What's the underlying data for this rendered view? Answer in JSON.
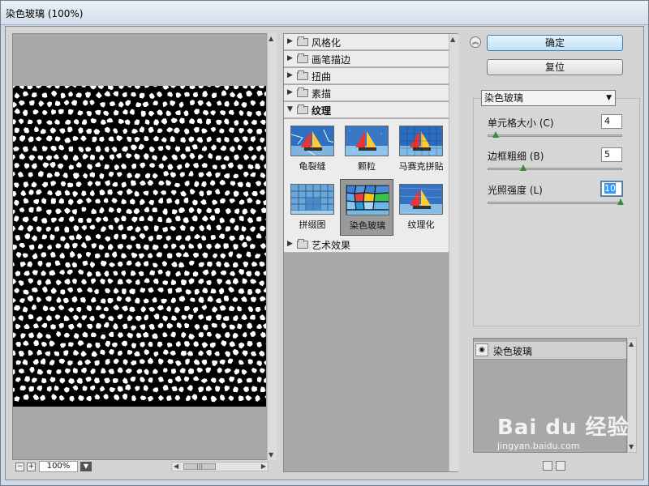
{
  "window": {
    "title": "染色玻璃 (100%)"
  },
  "preview": {
    "zoom": "100%",
    "zoom_out_glyph": "−",
    "zoom_in_glyph": "+"
  },
  "gallery": {
    "categories": [
      {
        "label": "风格化",
        "open": false
      },
      {
        "label": "画笔描边",
        "open": false
      },
      {
        "label": "扭曲",
        "open": false
      },
      {
        "label": "素描",
        "open": false
      },
      {
        "label": "纹理",
        "open": true
      },
      {
        "label": "艺术效果",
        "open": false
      }
    ],
    "texture_filters": [
      {
        "label": "龟裂缝",
        "icon": "craquelure-thumbnail",
        "selected": false
      },
      {
        "label": "颗粒",
        "icon": "grain-thumbnail",
        "selected": false
      },
      {
        "label": "马赛克拼贴",
        "icon": "mosaic-tiles-thumbnail",
        "selected": false
      },
      {
        "label": "拼缀图",
        "icon": "patchwork-thumbnail",
        "selected": false
      },
      {
        "label": "染色玻璃",
        "icon": "stained-glass-thumbnail",
        "selected": true
      },
      {
        "label": "纹理化",
        "icon": "texturizer-thumbnail",
        "selected": false
      }
    ]
  },
  "settings": {
    "ok_label": "确定",
    "reset_label": "复位",
    "selected_filter": "染色玻璃",
    "params": [
      {
        "label": "单元格大小 (C)",
        "value": "4",
        "level": 0.04
      },
      {
        "label": "边框粗细 (B)",
        "value": "5",
        "level": 0.25
      },
      {
        "label": "光照强度 (L)",
        "value": "10",
        "level": 1.0
      }
    ]
  },
  "layers": {
    "items": [
      {
        "name": "染色玻璃",
        "visible": true
      }
    ]
  },
  "watermark": {
    "main": "Bai du 经验",
    "sub": "jingyan.baidu.com"
  },
  "colors": {
    "accent": "#3399ff",
    "panel": "#a8a8a8",
    "button_primary": "#bfe0f6"
  }
}
